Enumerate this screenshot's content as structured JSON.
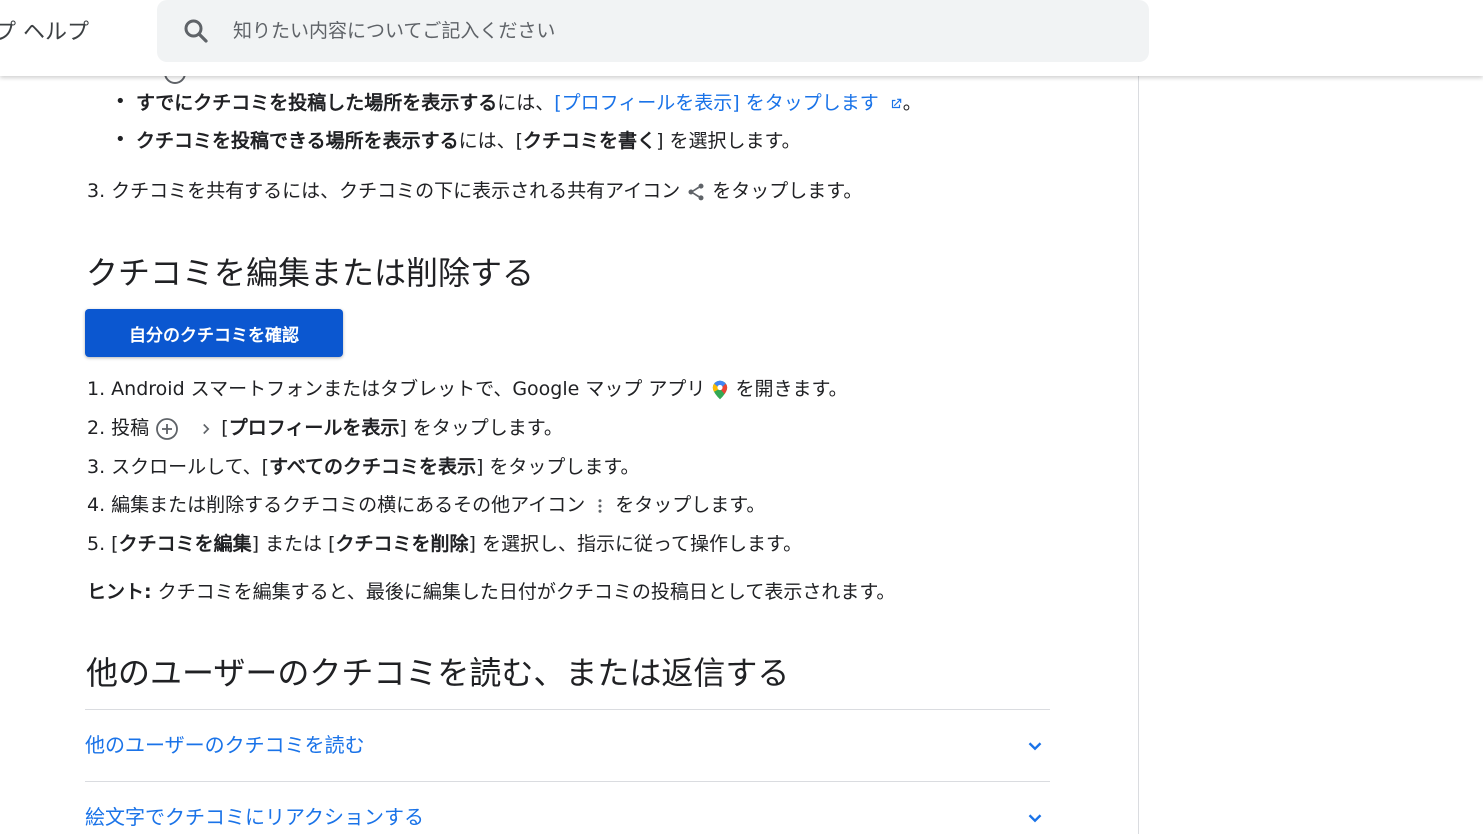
{
  "header": {
    "brand": "プ ヘルプ",
    "search_placeholder": "知りたい内容についてご記入ください"
  },
  "intro_list": {
    "bullet1": {
      "bold": "すでにクチコミを投稿した場所を表示する",
      "text": "には、",
      "link": "[プロフィールを表示] をタップします",
      "end": "。"
    },
    "bullet2": {
      "bold": "クチコミを投稿できる場所を表示する",
      "text1": "には、[",
      "bold2": "クチコミを書く",
      "text2": "] を選択します。"
    },
    "step3": {
      "text1": "3. クチコミを共有するには、クチコミの下に表示される共有アイコン ",
      "text2": " をタップします。"
    }
  },
  "section_edit": {
    "title": "クチコミを編集または削除する",
    "button": "自分のクチコミを確認",
    "steps": {
      "s1a": "1. Android スマートフォンまたはタブレットで、Google マップ アプリ ",
      "s1b": " を開きます。",
      "s2a": "2. 投稿 ",
      "s2b": " [",
      "s2bold": "プロフィールを表示",
      "s2c": "] をタップします。",
      "s3a": "3. スクロールして、[",
      "s3bold": "すべてのクチコミを表示",
      "s3b": "] をタップします。",
      "s4a": "4. 編集または削除するクチコミの横にあるその他アイコン ",
      "s4b": " をタップします。",
      "s5a": "5. [",
      "s5bold1": "クチコミを編集",
      "s5b": "] または [",
      "s5bold2": "クチコミを削除",
      "s5c": "] を選択し、指示に従って操作します。"
    },
    "hint_label": "ヒント:",
    "hint_text": " クチコミを編集すると、最後に編集した日付がクチコミの投稿日として表示されます。"
  },
  "section_read": {
    "title": "他のユーザーのクチコミを読む、または返信する",
    "accordion": [
      {
        "label": "他のユーザーのクチコミを読む"
      },
      {
        "label": "絵文字でクチコミにリアクションする"
      }
    ]
  },
  "colors": {
    "link": "#1a73e8",
    "button": "#0b57d0",
    "text": "#202124"
  }
}
